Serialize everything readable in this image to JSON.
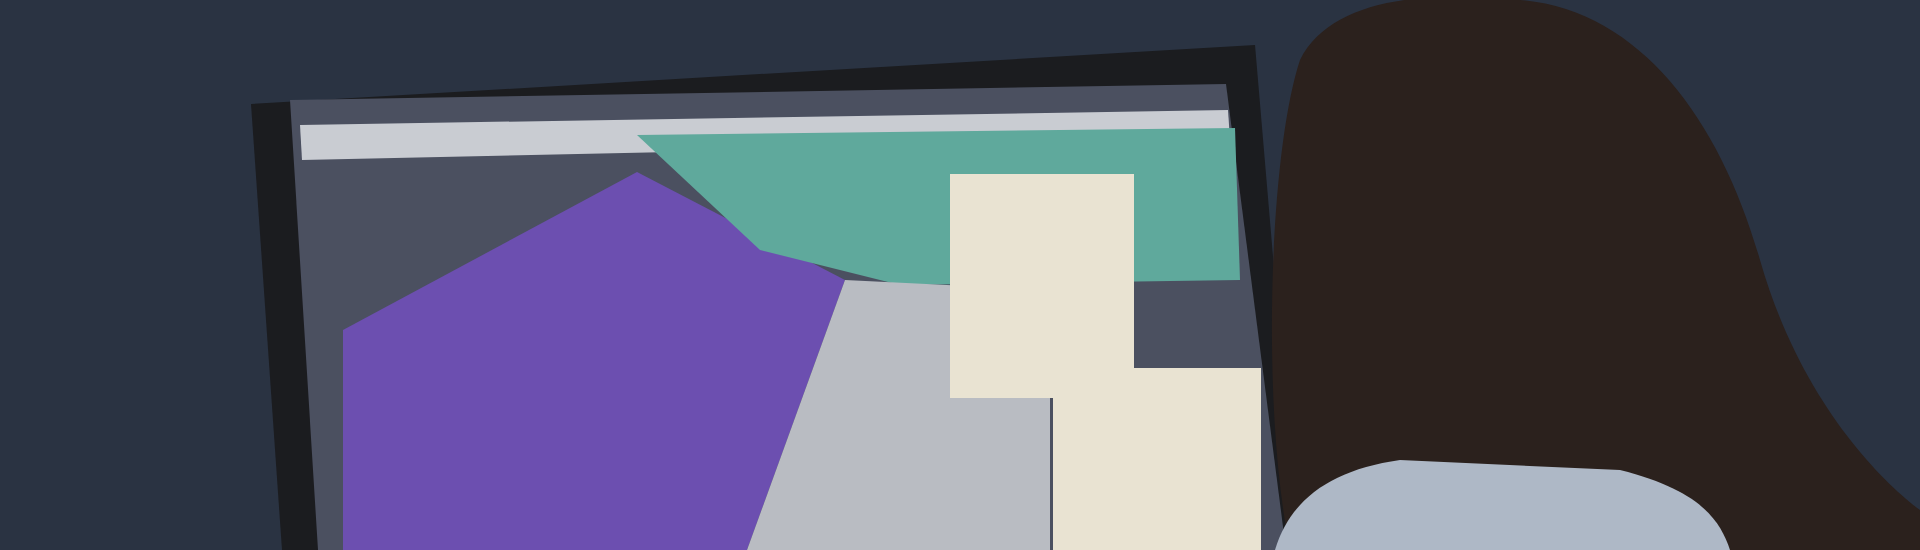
{
  "photo": {
    "kind": "office-scene"
  }
}
